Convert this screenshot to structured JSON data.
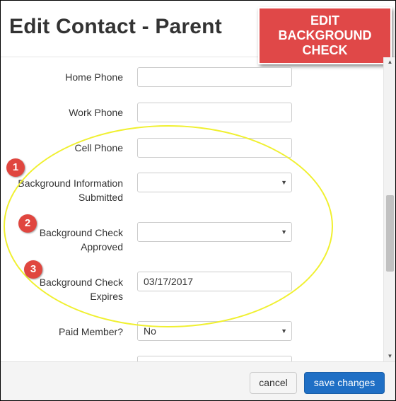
{
  "header": {
    "title": "Edit Contact - Parent"
  },
  "callout": {
    "text": "EDIT\nBACKGROUND\nCHECK",
    "color": "#e04848"
  },
  "form": {
    "home_phone": {
      "label": "Home Phone",
      "value": ""
    },
    "work_phone": {
      "label": "Work Phone",
      "value": ""
    },
    "cell_phone": {
      "label": "Cell Phone",
      "value": ""
    },
    "background_info": {
      "label_line1": "Background Information",
      "label_line2": "Submitted",
      "value": ""
    },
    "background_approved": {
      "label_line1": "Background Check",
      "label_line2": "Approved",
      "value": ""
    },
    "background_expires": {
      "label_line1": "Background Check",
      "label_line2": "Expires",
      "value": "03/17/2017"
    },
    "paid_member": {
      "label": "Paid Member?",
      "value": "No"
    },
    "next_field": {
      "value": ""
    }
  },
  "badges": [
    "1",
    "2",
    "3"
  ],
  "footer": {
    "cancel_label": "cancel",
    "save_label": "save changes"
  },
  "colors": {
    "save_button": "#1f6fc5",
    "badge": "#e0463f",
    "highlight_ring": "#f0f030"
  }
}
